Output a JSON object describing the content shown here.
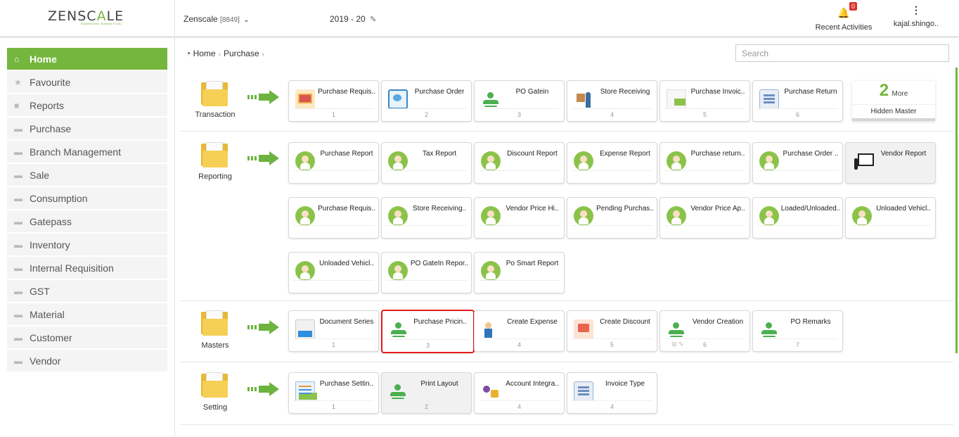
{
  "header": {
    "logo_text_a": "ZENSC",
    "logo_text_b": "A",
    "logo_text_c": "LE",
    "tagline": "Business Ease. Business Focus.",
    "company": "Zenscale",
    "company_code": "[8849]",
    "fiscal_year": "2019 - 20",
    "notifications_count": "0",
    "recent_activities": "Recent Activities",
    "user": "kajal.shingo.."
  },
  "sidebar": {
    "items": [
      {
        "label": "Home",
        "icon": "home-icon"
      },
      {
        "label": "Favourite",
        "icon": "star-icon"
      },
      {
        "label": "Reports",
        "icon": "file-icon"
      },
      {
        "label": "Purchase",
        "icon": "folder-icon"
      },
      {
        "label": "Branch Management",
        "icon": "folder-icon"
      },
      {
        "label": "Sale",
        "icon": "folder-icon"
      },
      {
        "label": "Consumption",
        "icon": "folder-icon"
      },
      {
        "label": "Gatepass",
        "icon": "folder-icon"
      },
      {
        "label": "Inventory",
        "icon": "folder-icon"
      },
      {
        "label": "Internal Requisition",
        "icon": "folder-icon"
      },
      {
        "label": "GST",
        "icon": "folder-icon"
      },
      {
        "label": "Material",
        "icon": "folder-icon"
      },
      {
        "label": "Customer",
        "icon": "folder-icon"
      },
      {
        "label": "Vendor",
        "icon": "folder-icon"
      }
    ]
  },
  "breadcrumb": {
    "home": "Home",
    "current": "Purchase"
  },
  "search": {
    "placeholder": "Search"
  },
  "sections": {
    "transaction": {
      "label": "Transaction",
      "tiles": [
        {
          "label": "Purchase Requis..",
          "num": "1"
        },
        {
          "label": "Purchase Order",
          "num": "2"
        },
        {
          "label": "PO Gatein",
          "num": "3"
        },
        {
          "label": "Store Receiving",
          "num": "4"
        },
        {
          "label": "Purchase Invoic..",
          "num": "5"
        },
        {
          "label": "Purchase Return",
          "num": "6"
        }
      ],
      "hidden_count": "2",
      "hidden_more": "More",
      "hidden_label": "Hidden Master"
    },
    "reporting": {
      "label": "Reporting",
      "tiles": [
        {
          "label": "Purchase Report"
        },
        {
          "label": "Tax Report"
        },
        {
          "label": "Discount Report"
        },
        {
          "label": "Expense Report"
        },
        {
          "label": "Purchase return.."
        },
        {
          "label": "Purchase Order .."
        },
        {
          "label": "Vendor Report"
        },
        {
          "label": "Purchase Requis.."
        },
        {
          "label": "Store Receiving.."
        },
        {
          "label": "Vendor Price Hi.."
        },
        {
          "label": "Pending Purchas.."
        },
        {
          "label": "Vendor Price Ap.."
        },
        {
          "label": "Loaded/Unloaded.."
        },
        {
          "label": "Unloaded Vehicl.."
        },
        {
          "label": "Unloaded Vehicl.."
        },
        {
          "label": "PO GateIn Repor.."
        },
        {
          "label": "Po Smart Report"
        }
      ]
    },
    "masters": {
      "label": "Masters",
      "tiles": [
        {
          "label": "Document Series",
          "num": "1"
        },
        {
          "label": "Purchase Pricin..",
          "num": "3"
        },
        {
          "label": "Create Expense",
          "num": "4"
        },
        {
          "label": "Create Discount",
          "num": "5"
        },
        {
          "label": "Vendor Creation",
          "num": "6"
        },
        {
          "label": "PO Remarks",
          "num": "7"
        }
      ]
    },
    "setting": {
      "label": "Setting",
      "tiles": [
        {
          "label": "Purchase Settin..",
          "num": "1"
        },
        {
          "label": "Print Layout",
          "num": "2"
        },
        {
          "label": "Account Integra..",
          "num": "4"
        },
        {
          "label": "Invoice Type",
          "num": "4"
        }
      ]
    }
  },
  "colors": {
    "accent": "#74b63e",
    "selected_border": "#e21b1b",
    "badge": "#d9342b"
  }
}
